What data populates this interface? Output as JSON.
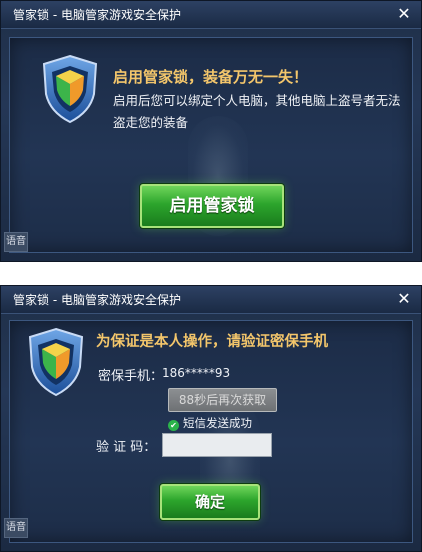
{
  "dialog1": {
    "title": "管家锁 - 电脑管家游戏安全保护",
    "close": "✕",
    "headline": "启用管家锁，装备万无一失！",
    "body": "启用后您可以绑定个人电脑，其他电脑上盗号者无法盗走您的装备",
    "button": "启用管家锁",
    "side_tab": "语音"
  },
  "dialog2": {
    "title": "管家锁 - 电脑管家游戏安全保护",
    "close": "✕",
    "headline": "为保证是本人操作，请验证密保手机",
    "phone_label": "密保手机：",
    "phone_value": "186*****93",
    "resend_button": "88秒后再次获取",
    "sms_status": "短信发送成功",
    "code_label": "验 证 码：",
    "code_value": "",
    "confirm_button": "确定",
    "side_tab": "语音"
  },
  "colors": {
    "headline": "#f3c66b",
    "button_green": "#2ca52c",
    "success_green": "#2bb34a"
  },
  "icons": {
    "shield": "shield-logo-icon",
    "close": "close-icon",
    "check": "check-icon"
  }
}
